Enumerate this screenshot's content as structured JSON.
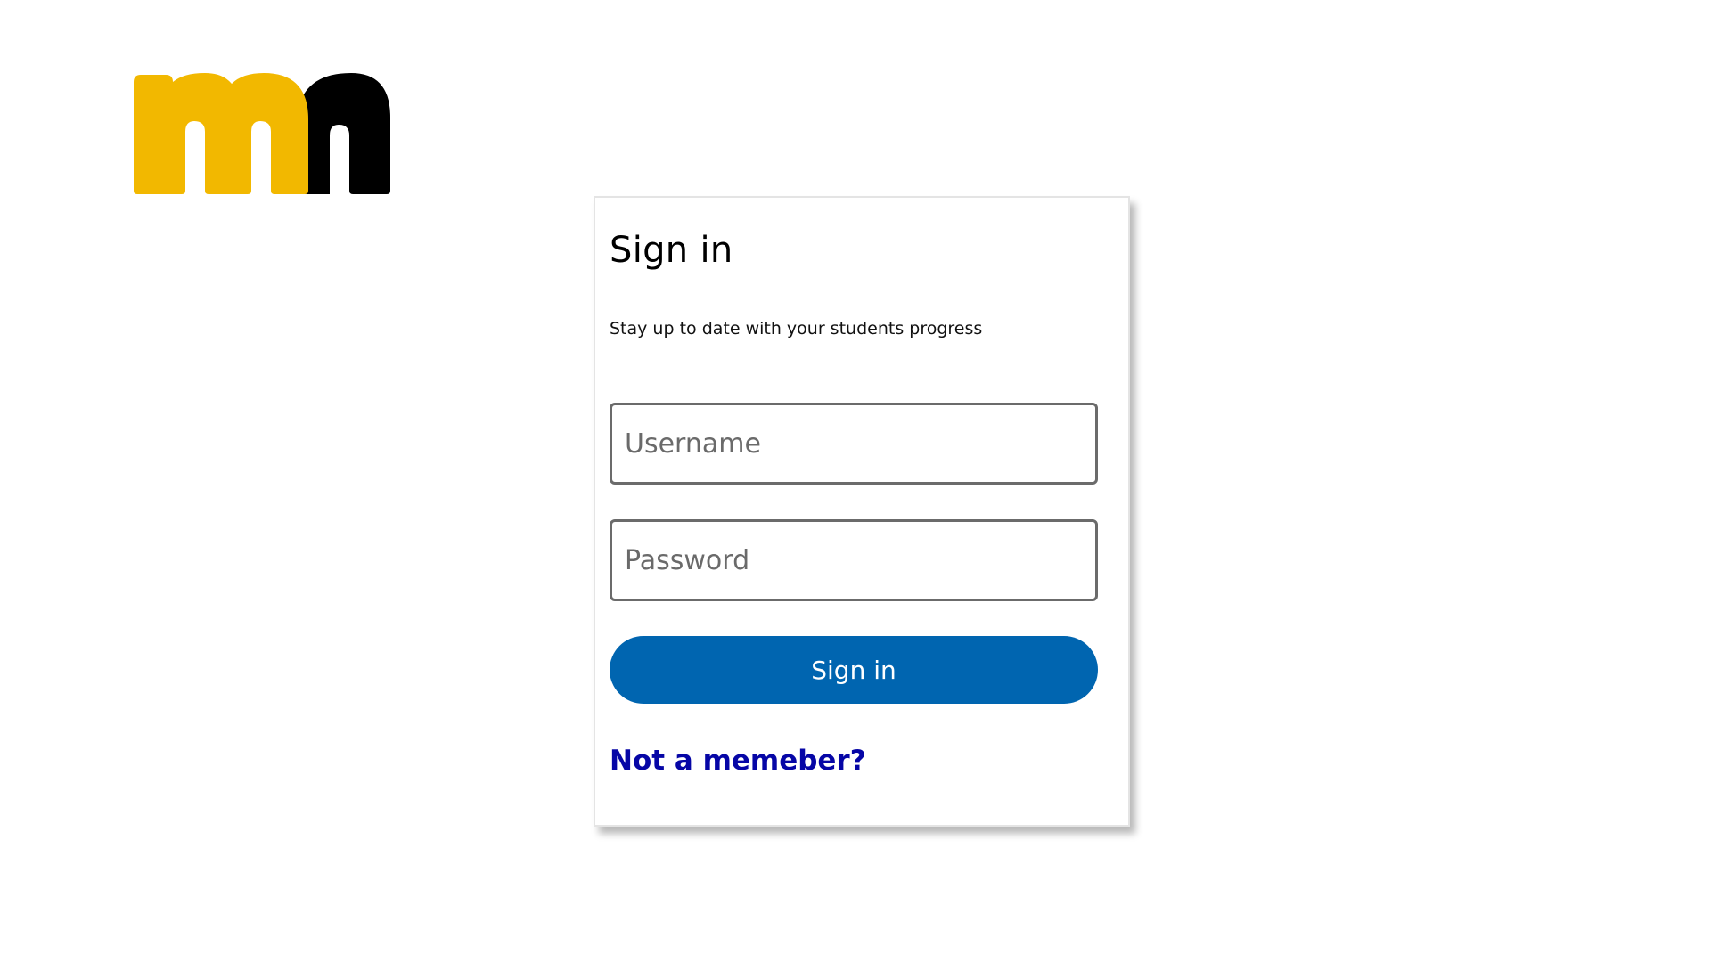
{
  "logo": {
    "name": "mn-logo",
    "colors": {
      "primary": "#f2b800",
      "secondary": "#000000"
    }
  },
  "signin": {
    "title": "Sign in",
    "subtitle": "Stay up to date with your students progress",
    "username_placeholder": "Username",
    "password_placeholder": "Password",
    "submit_label": "Sign in",
    "register_link": "Not a memeber?"
  },
  "colors": {
    "button_bg": "#0065b0",
    "link": "#0606a6",
    "field_border": "#6b6b6b"
  }
}
